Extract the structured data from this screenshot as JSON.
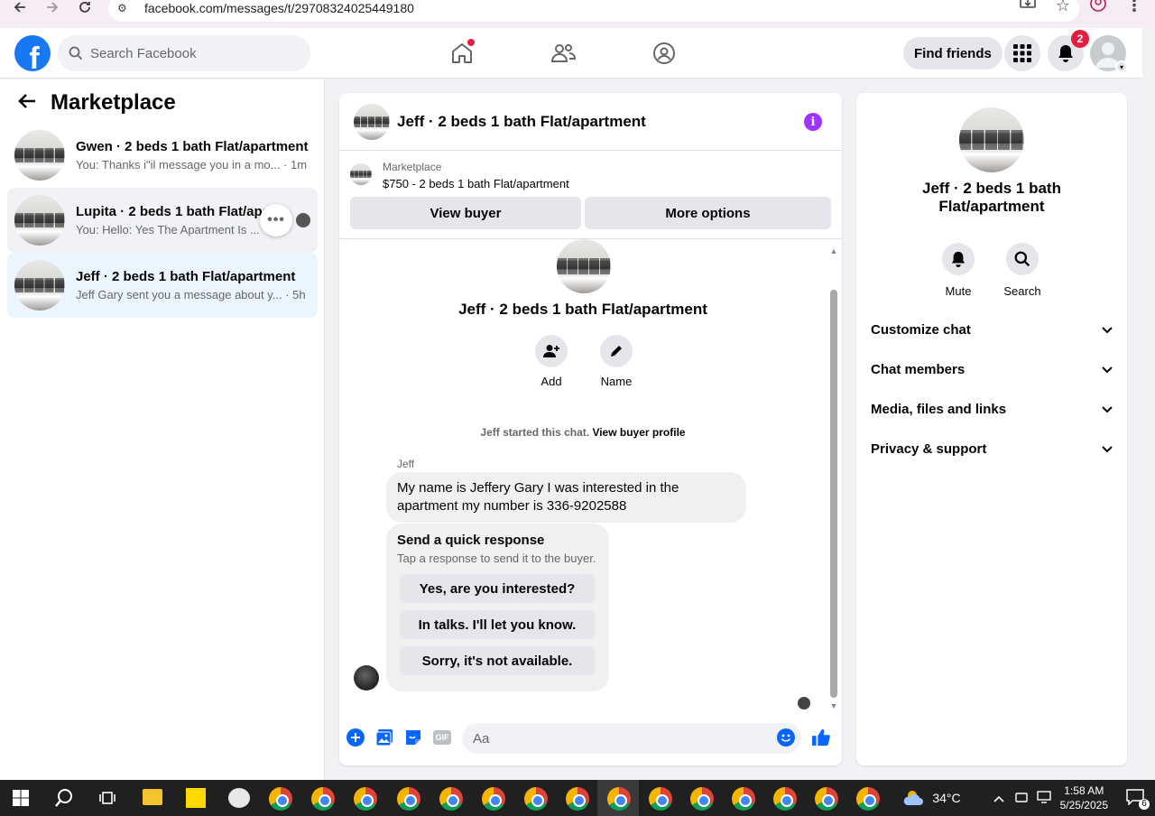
{
  "browser": {
    "url": "facebook.com/messages/t/29708324025449180"
  },
  "topbar": {
    "search_placeholder": "Search Facebook",
    "find_friends": "Find friends",
    "notifications_count": "2"
  },
  "sidebar": {
    "title": "Marketplace",
    "conversations": [
      {
        "name": "Gwen · 2 beds 1 bath Flat/apartment",
        "snippet": "You: Thanks i\"il message you in a mo... · 1m"
      },
      {
        "name": "Lupita · 2 beds 1 bath Flat/apar",
        "snippet": "You: Hello: Yes The Apartment Is ..."
      },
      {
        "name": "Jeff · 2 beds 1 bath Flat/apartment",
        "snippet": "Jeff Gary sent you a message about y... · 5h"
      }
    ]
  },
  "chat": {
    "header_title": "Jeff · 2 beds 1 bath Flat/apartment",
    "marketplace_label": "Marketplace",
    "listing_price_title": "$750 - 2 beds 1 bath Flat/apartment",
    "view_buyer": "View buyer",
    "more_options": "More options",
    "intro_title": "Jeff · 2 beds 1 bath Flat/apartment",
    "add_label": "Add",
    "name_label": "Name",
    "started_text": "Jeff started this chat.",
    "view_buyer_profile": "View buyer profile",
    "sender": "Jeff",
    "message": "My name is Jeffery Gary I was interested in the apartment my number is 336-9202588",
    "quick_title": "Send a quick response",
    "quick_sub": "Tap a response to send it to the buyer.",
    "quick_replies": [
      "Yes, are you interested?",
      "In talks. I'll let you know.",
      "Sorry, it's not available."
    ],
    "composer_placeholder": "Aa",
    "gif_label": "GIF"
  },
  "details": {
    "title": "Jeff · 2 beds 1 bath Flat/apartment",
    "mute": "Mute",
    "search": "Search",
    "rows": [
      "Customize chat",
      "Chat members",
      "Media, files and links",
      "Privacy & support"
    ]
  },
  "taskbar": {
    "weather": "34°C",
    "time": "1:58 AM",
    "date": "5/25/2025",
    "notif_count": "6"
  },
  "colors": {
    "brand": "#1877f2",
    "active_conv": "#ebf5ff",
    "info_purple": "#a033ff",
    "badge_red": "#e41e3f"
  }
}
